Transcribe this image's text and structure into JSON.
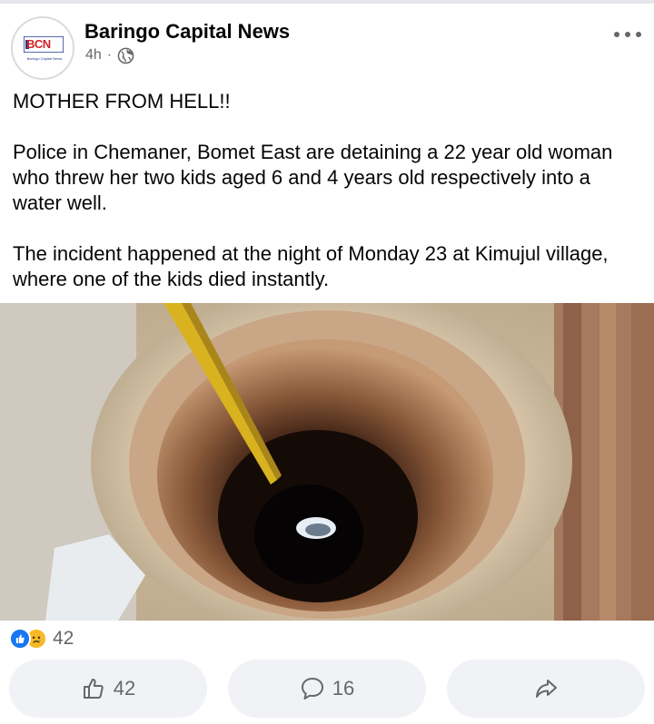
{
  "post": {
    "page_name": "Baringo Capital News",
    "time": "4h",
    "separator": "·",
    "avatar": {
      "logo_text": "BCN",
      "logo_sub": "Baringo Capital News"
    },
    "text": {
      "headline": "MOTHER FROM HELL!!",
      "paragraph1": "Police in Chemaner, Bomet East are detaining a 22 year old woman who threw her two kids aged 6 and 4 years old respectively into a water well.",
      "paragraph2": "The incident happened at the night of Monday 23 at Kimujul village, where one of the kids died instantly."
    },
    "reactions": {
      "icons": [
        "like-icon",
        "sad-icon"
      ],
      "count": "42"
    },
    "actions": {
      "like_count": "42",
      "comment_count": "16"
    }
  },
  "colors": {
    "accent": "#1877f2",
    "muted": "#65676b",
    "button_bg": "#f0f2f5"
  }
}
